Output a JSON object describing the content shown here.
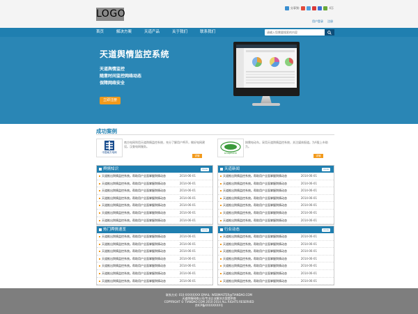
{
  "header": {
    "logo": "LOGO",
    "share_label": "分享到:",
    "share_count": "4万",
    "links": [
      "用户登录",
      "注册"
    ]
  },
  "nav": {
    "items": [
      "首页",
      "解决方案",
      "天道产品",
      "关于我们",
      "联系我们"
    ],
    "search_placeholder": "请输入您需要搜索的内容",
    "search_icon": "search-icon"
  },
  "hero": {
    "title": "天道舆情监控系统",
    "lines": [
      "天道舆情监控",
      "随意时间监控网络动态",
      "保障网络安全"
    ],
    "cta": "立即注册"
  },
  "cases": {
    "title": "成功案例",
    "items": [
      {
        "logo_text": "中国南方电网",
        "text": "南方电网利用天道舆情监控系统，充分了解用户呼声，做好电网建设。汉查电网服务。",
        "more": "详情"
      },
      {
        "logo_text": "sinopharm",
        "text": "按需电动车。采用天道舆情监控系统，关注媒体报道。为A股上市助力。",
        "more": "详情"
      }
    ]
  },
  "panels": [
    {
      "title": "舆情知识",
      "more": "more",
      "rows": [
        {
          "text": "天道推出舆情监控系统。帮助用户全面掌握舆情动态",
          "date": "2014-06-01"
        },
        {
          "text": "天道推出舆情监控系统。帮助用户全面掌握舆情动态",
          "date": "2014-06-01"
        },
        {
          "text": "天道推出舆情监控系统。帮助用户全面掌握舆情动态",
          "date": "2014-06-01"
        },
        {
          "text": "天道推出舆情监控系统。帮助用户全面掌握舆情动态",
          "date": "2014-06-01"
        },
        {
          "text": "天道推出舆情监控系统。帮助用户全面掌握舆情动态",
          "date": "2014-06-01"
        },
        {
          "text": "天道推出舆情监控系统。帮助用户全面掌握舆情动态",
          "date": "2014-06-01"
        },
        {
          "text": "天道推出舆情监控系统。帮助用户全面掌握舆情动态",
          "date": "2014-06-01"
        }
      ]
    },
    {
      "title": "天道新闻",
      "more": "more",
      "rows": [
        {
          "text": "天道推出舆情监控系统。帮助用户全面掌握舆情动态",
          "date": "2014-06-01"
        },
        {
          "text": "天道推出舆情监控系统。帮助用户全面掌握舆情动态",
          "date": "2014-06-01"
        },
        {
          "text": "天道推出舆情监控系统。帮助用户全面掌握舆情动态",
          "date": "2014-06-01"
        },
        {
          "text": "天道推出舆情监控系统。帮助用户全面掌握舆情动态",
          "date": "2014-06-01"
        },
        {
          "text": "天道推出舆情监控系统。帮助用户全面掌握舆情动态",
          "date": "2014-06-01"
        },
        {
          "text": "天道推出舆情监控系统。帮助用户全面掌握舆情动态",
          "date": "2014-06-01"
        },
        {
          "text": "天道推出舆情监控系统。帮助用户全面掌握舆情动态",
          "date": "2014-06-01"
        }
      ]
    },
    {
      "title": "热门舆情速览",
      "more": "more",
      "rows": [
        {
          "text": "天道推出舆情监控系统。帮助用户全面掌握舆情动态",
          "date": "2014-06-01"
        },
        {
          "text": "天道推出舆情监控系统。帮助用户全面掌握舆情动态",
          "date": "2014-06-01"
        },
        {
          "text": "天道推出舆情监控系统。帮助用户全面掌握舆情动态",
          "date": "2014-06-01"
        },
        {
          "text": "天道推出舆情监控系统。帮助用户全面掌握舆情动态",
          "date": "2014-06-01"
        },
        {
          "text": "天道推出舆情监控系统。帮助用户全面掌握舆情动态",
          "date": "2014-06-01"
        },
        {
          "text": "天道推出舆情监控系统。帮助用户全面掌握舆情动态",
          "date": "2014-06-01"
        },
        {
          "text": "天道推出舆情监控系统。帮助用户全面掌握舆情动态",
          "date": "2014-06-01"
        }
      ]
    },
    {
      "title": "行业动态",
      "more": "more",
      "rows": [
        {
          "text": "天道推出舆情监控系统。帮助用户全面掌握舆情动态",
          "date": "2014-06-01"
        },
        {
          "text": "天道推出舆情监控系统。帮助用户全面掌握舆情动态",
          "date": "2014-06-01"
        },
        {
          "text": "天道推出舆情监控系统。帮助用户全面掌握舆情动态",
          "date": "2014-06-01"
        },
        {
          "text": "天道推出舆情监控系统。帮助用户全面掌握舆情动态",
          "date": "2014-06-01"
        },
        {
          "text": "天道推出舆情监控系统。帮助用户全面掌握舆情动态",
          "date": "2014-06-01"
        },
        {
          "text": "天道推出舆情监控系统。帮助用户全面掌握舆情动态",
          "date": "2014-06-01"
        },
        {
          "text": "天道推出舆情监控系统。帮助用户全面掌握舆情动态",
          "date": "2014-06-01"
        }
      ]
    }
  ],
  "footer": {
    "lines": [
      "联系方式: 010-XXXXXXXX EMAIL: WEBMASTER@TIANDAO.COM",
      "天道舆情网络公司/专业企业解决方案提供商",
      "COPYRIGHT © TIANDAO.COM 2010-2014 ALL RIGHTS RESERVED",
      "京ICP备XXXXXXXX号"
    ]
  },
  "colors": {
    "nav": "#1f7fb0",
    "hero": "#2a86b5",
    "accent": "#f29a1c",
    "footer": "#7e7e7e"
  }
}
